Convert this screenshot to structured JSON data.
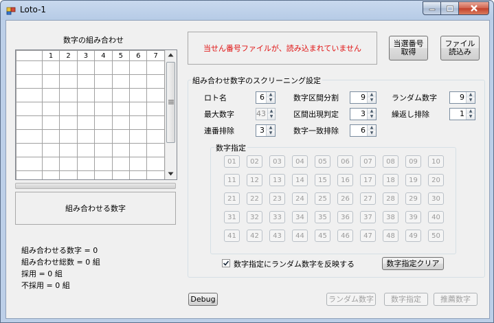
{
  "window": {
    "title": "Loto-1"
  },
  "left": {
    "combo_label": "数字の組み合わせ",
    "grid_headers": [
      "",
      "1",
      "2",
      "3",
      "4",
      "5",
      "6",
      "7"
    ],
    "combine_numbers_label": "組み合わせる数字",
    "stats": [
      "組み合わせる数字 = 0",
      "組み合わせ総数 = 0 組",
      "採用 = 0 組",
      "不採用 = 0 組"
    ]
  },
  "top": {
    "status_message": "当せん番号ファイルが、読み込まれていません",
    "status_color": "#e01010",
    "get_winning_button": "当選番号\n取得",
    "load_file_button": "ファイル\n読込み"
  },
  "screening": {
    "title": "組み合わせ数字のスクリーニング設定",
    "loto_name_label": "ロト名",
    "loto_name_value": "6",
    "max_number_label": "最大数字",
    "max_number_value": "43",
    "consecutive_label": "連番排除",
    "consecutive_value": "3",
    "interval_split_label": "数字区間分割",
    "interval_split_value": "9",
    "interval_appear_label": "区間出現判定",
    "interval_appear_value": "3",
    "match_exclude_label": "数字一致排除",
    "match_exclude_value": "6",
    "random_number_label": "ランダム数字",
    "random_number_value": "9",
    "repeat_exclude_label": "繰返し排除",
    "repeat_exclude_value": "1",
    "number_spec_title": "数字指定",
    "numbers": [
      "01",
      "02",
      "03",
      "04",
      "05",
      "06",
      "07",
      "08",
      "09",
      "10",
      "11",
      "12",
      "13",
      "14",
      "15",
      "16",
      "17",
      "18",
      "19",
      "20",
      "21",
      "22",
      "23",
      "24",
      "25",
      "26",
      "27",
      "28",
      "29",
      "30",
      "31",
      "32",
      "33",
      "34",
      "35",
      "36",
      "37",
      "38",
      "39",
      "40",
      "41",
      "42",
      "43",
      "44",
      "45",
      "46",
      "47",
      "48",
      "49",
      "50"
    ],
    "reflect_random_label": "数字指定にランダム数字を反映する",
    "reflect_random_checked": true,
    "clear_button": "数字指定クリア"
  },
  "bottom": {
    "debug_button": "Debug",
    "random_button": "ランダム数字",
    "spec_button": "数字指定",
    "recommend_button": "推薦数字"
  }
}
